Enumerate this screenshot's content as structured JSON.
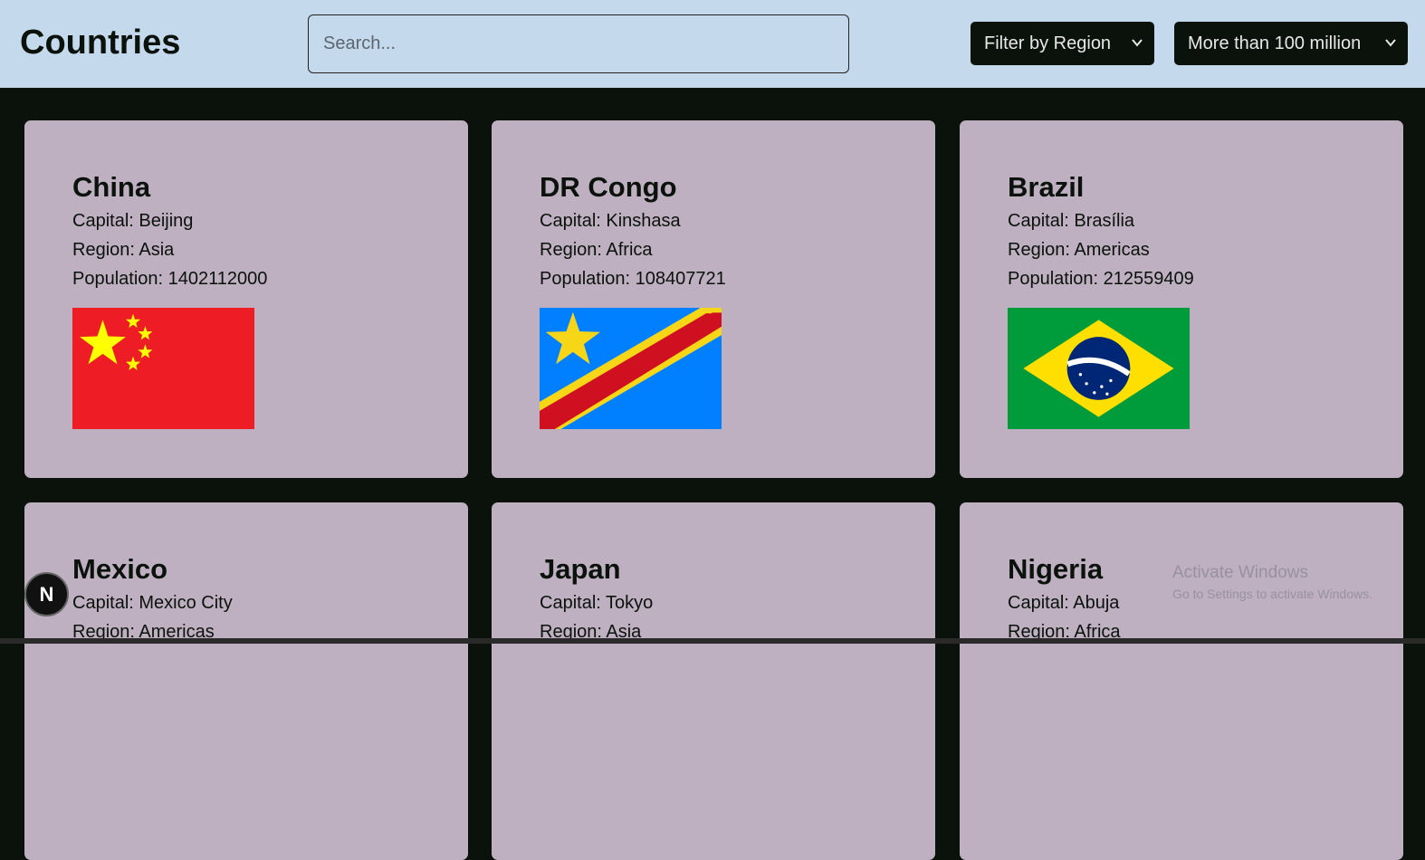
{
  "header": {
    "title": "Countries",
    "search_placeholder": "Search...",
    "region_filter": "Filter by Region",
    "population_filter": "More than 100 million"
  },
  "countries": [
    {
      "name": "China",
      "capital": "Capital: Beijing",
      "region": "Region: Asia",
      "population": "Population: 1402112000",
      "flag": "china-flag"
    },
    {
      "name": "DR Congo",
      "capital": "Capital: Kinshasa",
      "region": "Region: Africa",
      "population": "Population: 108407721",
      "flag": "dr-congo-flag"
    },
    {
      "name": "Brazil",
      "capital": "Capital: Brasília",
      "region": "Region: Americas",
      "population": "Population: 212559409",
      "flag": "brazil-flag"
    },
    {
      "name": "Mexico",
      "capital": "Capital: Mexico City",
      "region": "Region: Americas"
    },
    {
      "name": "Japan",
      "capital": "Capital: Tokyo",
      "region": "Region: Asia"
    },
    {
      "name": "Nigeria",
      "capital": "Capital: Abuja",
      "region": "Region: Africa"
    }
  ],
  "badge": {
    "label": "N"
  },
  "watermark": {
    "line1": "Activate Windows",
    "line2": "Go to Settings to activate Windows."
  },
  "colors": {
    "header_bg": "#c5d9ec",
    "page_bg": "#0b120c",
    "card_bg": "#beb0c1"
  }
}
